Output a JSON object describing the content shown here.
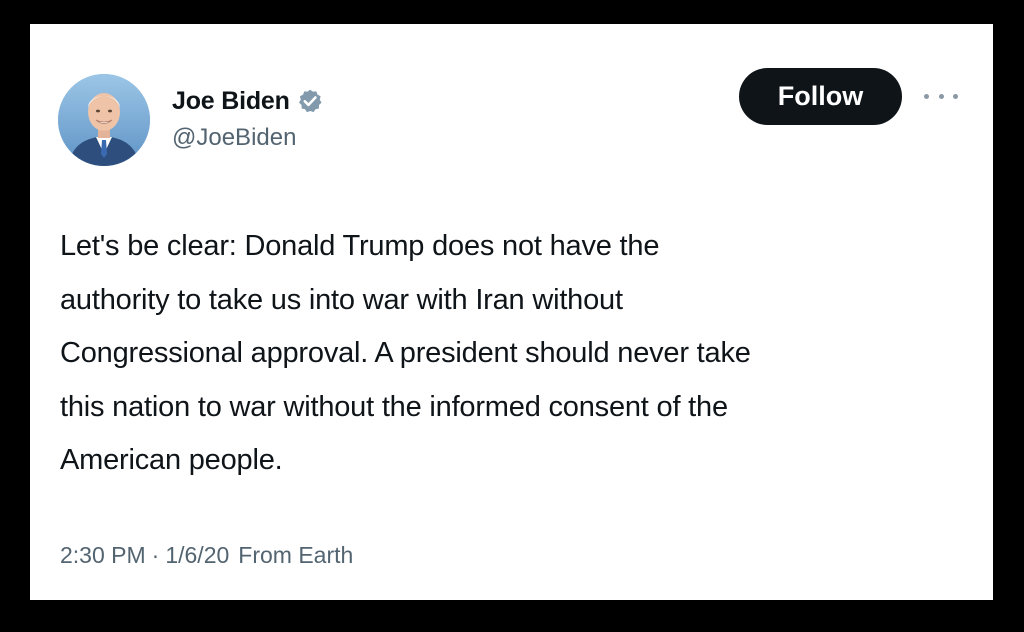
{
  "author": {
    "display_name": "Joe Biden",
    "handle": "@JoeBiden",
    "verified": true,
    "avatar_icon": "profile-photo"
  },
  "actions": {
    "follow_label": "Follow",
    "more_icon": "ellipsis-icon"
  },
  "tweet": {
    "text": "Let's be clear: Donald Trump does not have the\nauthority to take us into war with Iran without\nCongressional approval. A president should never take\nthis nation to war without the informed consent of the\nAmerican people."
  },
  "meta": {
    "time": "2:30 PM",
    "separator": "·",
    "date": "1/6/20",
    "source": "From Earth"
  },
  "colors": {
    "background": "#000000",
    "card": "#ffffff",
    "text_primary": "#0f1419",
    "text_secondary": "#536471",
    "verified_badge": "#829aab",
    "follow_button": "#0f1419"
  }
}
